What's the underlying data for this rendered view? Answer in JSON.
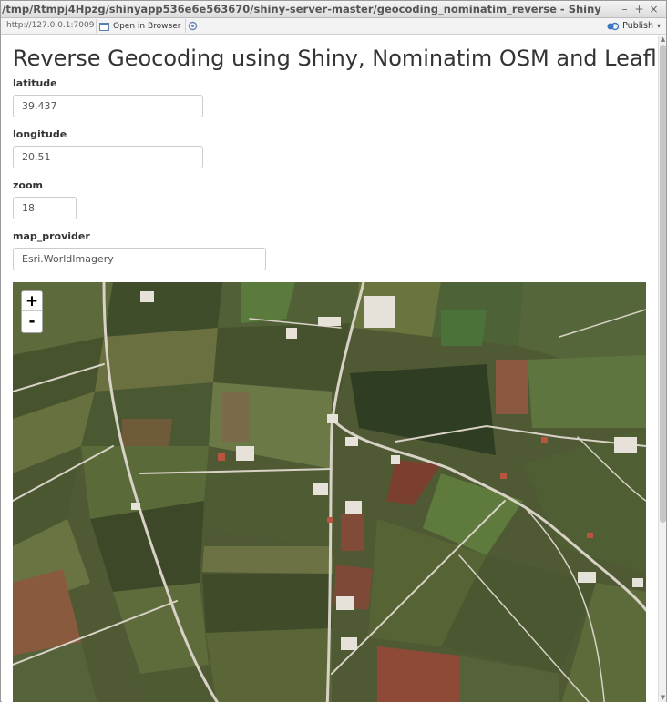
{
  "window": {
    "title": "/tmp/Rtmpj4Hpzg/shinyapp536e6e563670/shiny-server-master/geocoding_nominatim_reverse - Shiny",
    "controls": {
      "minimize": "–",
      "maximize": "+",
      "close": "×"
    }
  },
  "toolbar": {
    "url": "http://127.0.0.1:7009",
    "open_in_browser": "Open in Browser",
    "publish": "Publish"
  },
  "app": {
    "heading": "Reverse Geocoding using Shiny, Nominatim OSM and Leaflet",
    "inputs": {
      "latitude": {
        "label": "latitude",
        "value": "39.437"
      },
      "longitude": {
        "label": "longitude",
        "value": "20.51"
      },
      "zoom": {
        "label": "zoom",
        "value": "18"
      },
      "map_provider": {
        "label": "map_provider",
        "value": "Esri.WorldImagery"
      }
    }
  },
  "map": {
    "zoom_in": "+",
    "zoom_out": "-"
  },
  "colors": {
    "field_green_dark": "#3d4a2a",
    "field_green": "#5d6b3d",
    "field_brown": "#8a5a3e",
    "road": "#d8d2c6"
  }
}
